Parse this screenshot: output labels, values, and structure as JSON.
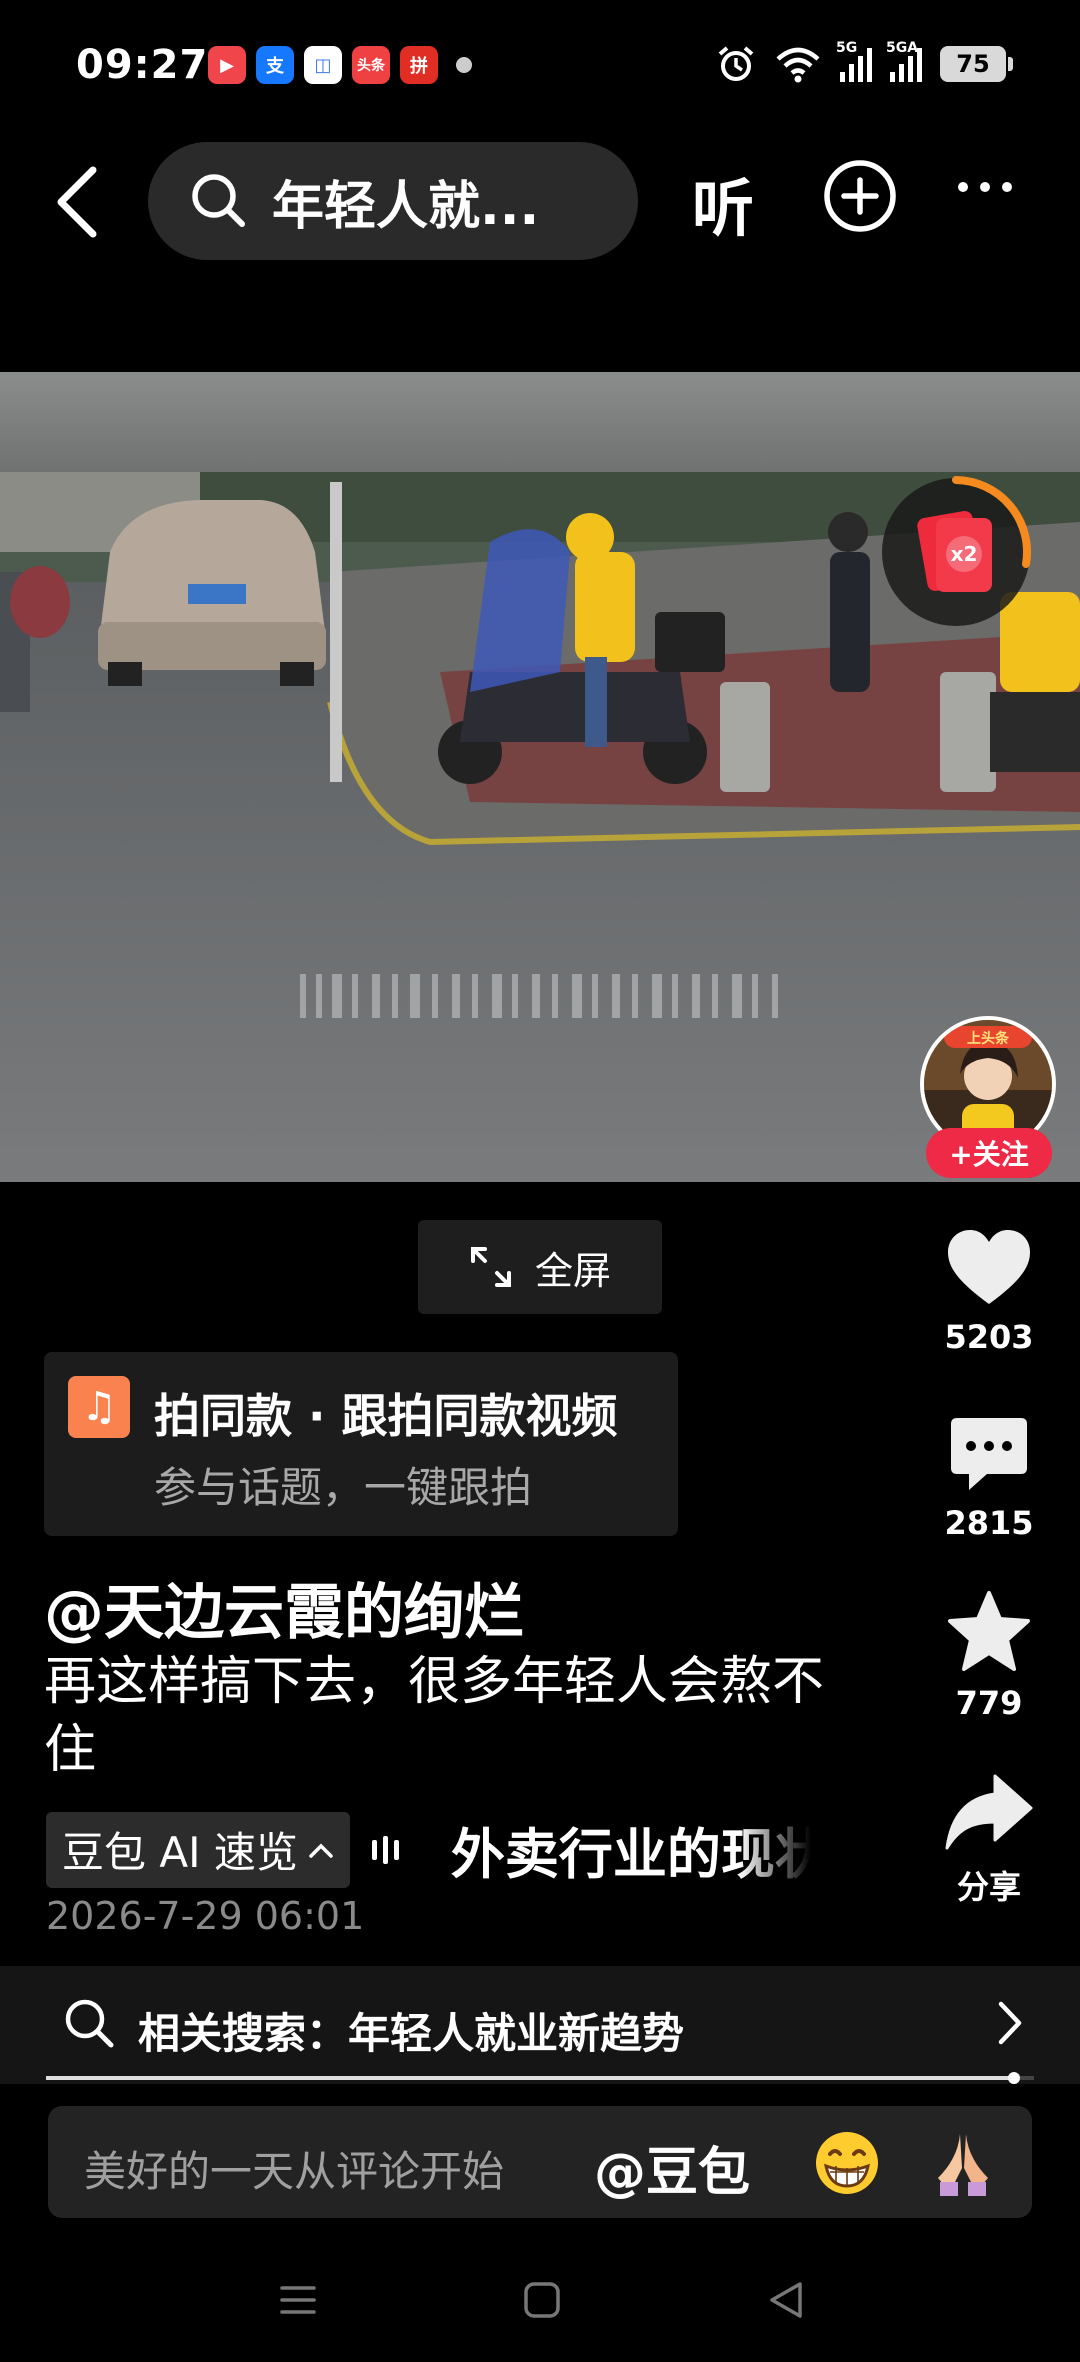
{
  "status_bar": {
    "time": "09:27",
    "app_icons": [
      {
        "name": "video-app-icon",
        "label": "▶",
        "color": "#f0454a"
      },
      {
        "name": "alipay-icon",
        "label": "支",
        "color": "#1677ff"
      },
      {
        "name": "album-app-icon",
        "label": "◫",
        "color": "#ffffff"
      },
      {
        "name": "toutiao-icon",
        "label": "头条",
        "color": "#f04142"
      },
      {
        "name": "pdd-icon",
        "label": "拼",
        "color": "#e02e24"
      }
    ],
    "network_1": "5G",
    "network_2": "5GA",
    "battery": "75"
  },
  "top_nav": {
    "search_text": "年轻人就...",
    "listen_label": "听"
  },
  "video": {
    "redpacket_multiplier": "x2",
    "follow_label": "+关注",
    "avatar_badge": "上头条"
  },
  "fullscreen_label": "全屏",
  "actions": {
    "like_count": "5203",
    "comment_count": "2815",
    "favorite_count": "779",
    "share_label": "分享"
  },
  "same_style": {
    "title": "拍同款 · 跟拍同款视频",
    "subtitle": "参与话题，一键跟拍"
  },
  "post": {
    "author": "@天边云霞的绚烂",
    "caption": "再这样搞下去，很多年轻人会熬不住",
    "ai_chip_label": "豆包 AI 速览",
    "ai_preview": "外卖行业的现状",
    "date": "2026-7-29 06:01"
  },
  "related_search": {
    "label": "相关搜索：年轻人就业新趋势"
  },
  "progress": {
    "played_fraction": 0.98
  },
  "comment_bar": {
    "placeholder": "美好的一天从评论开始",
    "mention": "@豆包",
    "emoji_1": "😁",
    "emoji_2": "🙏"
  }
}
